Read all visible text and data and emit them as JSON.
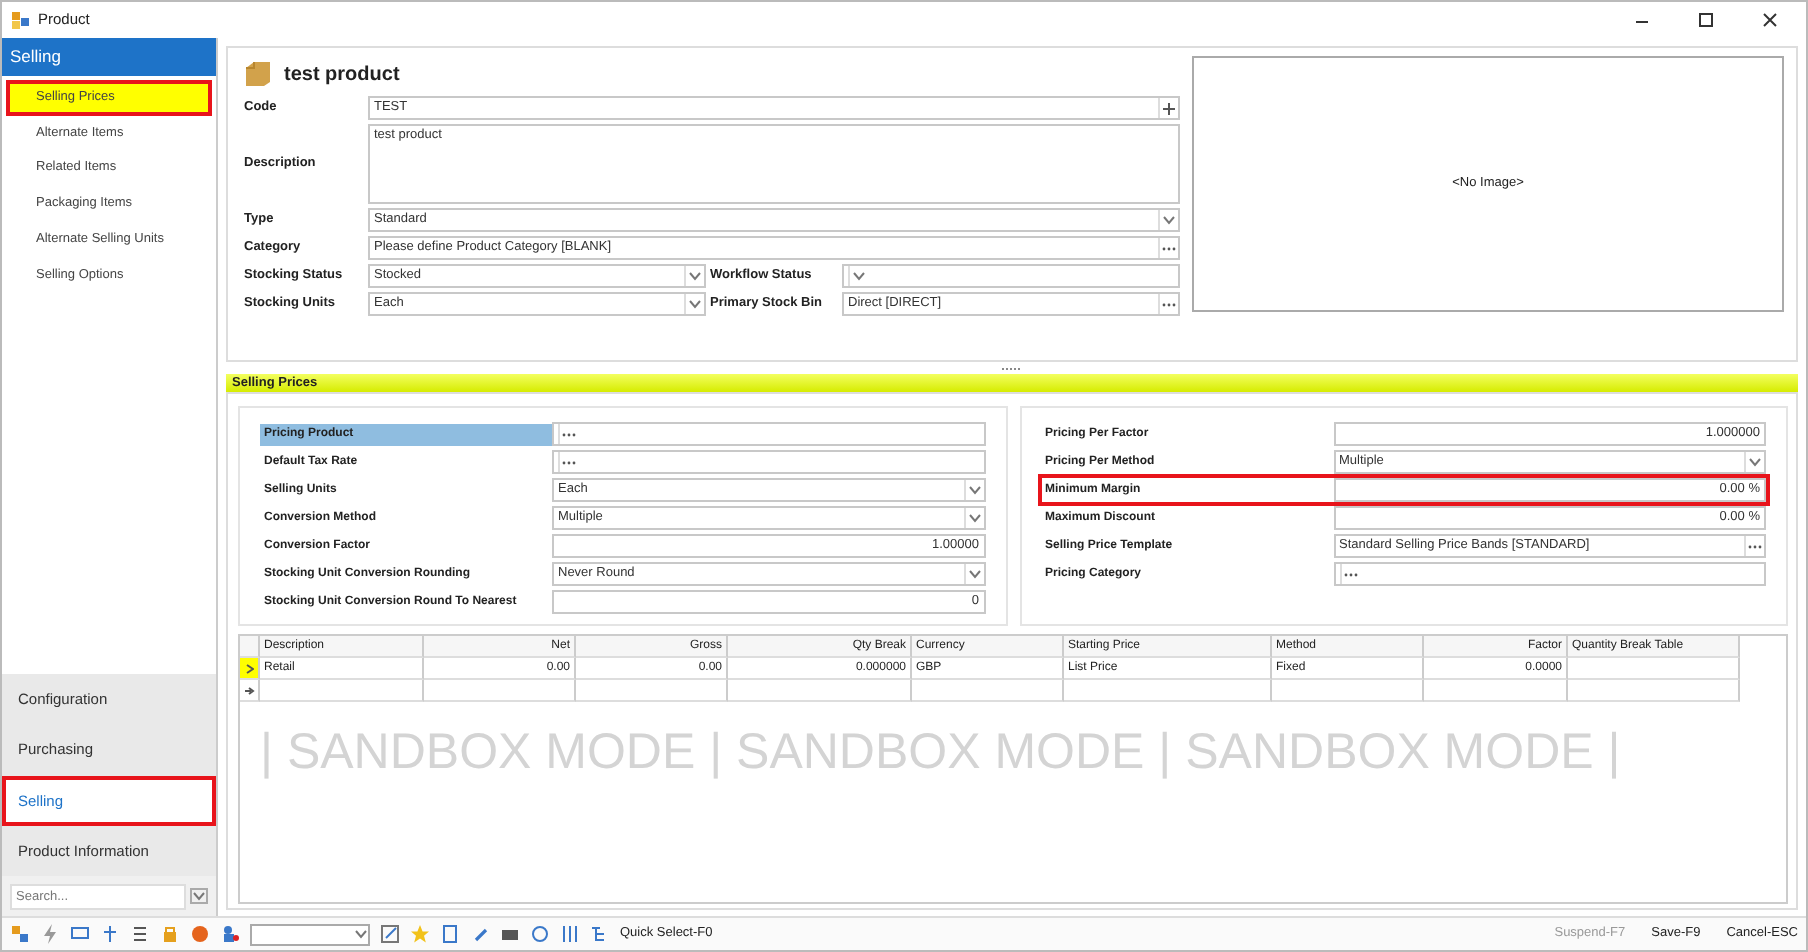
{
  "window": {
    "title": "Product"
  },
  "sidebar": {
    "header": "Selling",
    "items": [
      {
        "label": "Selling Prices",
        "selected": true,
        "highlighted": true
      },
      {
        "label": "Alternate Items",
        "selected": false,
        "highlighted": false
      },
      {
        "label": "Related Items",
        "selected": false,
        "highlighted": false
      },
      {
        "label": "Packaging Items",
        "selected": false,
        "highlighted": false
      },
      {
        "label": "Alternate Selling Units",
        "selected": false,
        "highlighted": false
      },
      {
        "label": "Selling Options",
        "selected": false,
        "highlighted": false
      }
    ],
    "nav": [
      {
        "label": "Configuration",
        "selected": false,
        "highlighted": false
      },
      {
        "label": "Purchasing",
        "selected": false,
        "highlighted": false
      },
      {
        "label": "Selling",
        "selected": true,
        "highlighted": true
      },
      {
        "label": "Product Information",
        "selected": false,
        "highlighted": false
      }
    ],
    "search": {
      "placeholder": "Search..."
    }
  },
  "product": {
    "name": "test product",
    "rows": [
      [
        {
          "label": "Code",
          "value": "TEST",
          "kind": "code"
        }
      ],
      [
        {
          "label": "Description",
          "value": "test product",
          "kind": "memo"
        }
      ],
      [
        {
          "label": "Type",
          "value": "Standard",
          "kind": "dropdown"
        }
      ],
      [
        {
          "label": "Category",
          "value": "Please define Product Category [BLANK]",
          "kind": "lookup"
        }
      ],
      [
        {
          "label": "Stocking Status",
          "value": "Stocked",
          "kind": "dropdown"
        },
        {
          "label": "Workflow Status",
          "kind": "dropdown"
        }
      ],
      [
        {
          "label": "Stocking Units",
          "value": "Each",
          "kind": "dropdown"
        },
        {
          "label": "Primary Stock Bin",
          "value": "Direct [DIRECT]",
          "kind": "lookup"
        }
      ]
    ],
    "image": {
      "text": "<No Image>"
    }
  },
  "section": {
    "title": "Selling Prices"
  },
  "pricing_left": [
    {
      "label": "Pricing Product",
      "kind": "lookup",
      "focused": true
    },
    {
      "label": "Default Tax Rate",
      "kind": "lookup",
      "focused": false
    },
    {
      "label": "Selling Units",
      "value": "Each",
      "kind": "dropdown",
      "focused": false
    },
    {
      "label": "Conversion Method",
      "value": "Multiple",
      "kind": "dropdown",
      "focused": false
    },
    {
      "label": "Conversion Factor",
      "value": "1.00000",
      "kind": "number",
      "focused": false
    },
    {
      "label": "Stocking Unit Conversion Rounding",
      "value": "Never Round",
      "kind": "dropdown",
      "focused": false
    },
    {
      "label": "Stocking Unit Conversion Round To Nearest",
      "value": "0",
      "kind": "number",
      "focused": false
    }
  ],
  "pricing_right": [
    {
      "label": "Pricing Per Factor",
      "value": "1.000000",
      "kind": "number",
      "focused": false
    },
    {
      "label": "Pricing Per Method",
      "value": "Multiple",
      "kind": "dropdown",
      "focused": false
    },
    {
      "label": "Minimum Margin",
      "value": "0.00 %",
      "kind": "number",
      "focused": false,
      "highlighted": true
    },
    {
      "label": "Maximum Discount",
      "value": "0.00 %",
      "kind": "number",
      "focused": false
    },
    {
      "label": "Selling Price Template",
      "value": "Standard Selling Price Bands [STANDARD]",
      "kind": "lookup",
      "focused": false
    },
    {
      "label": "Pricing Category",
      "kind": "lookup",
      "focused": false
    }
  ],
  "grid": {
    "columns": [
      {
        "label": "Description",
        "kind": "text"
      },
      {
        "label": "Net",
        "kind": "number"
      },
      {
        "label": "Gross",
        "kind": "number"
      },
      {
        "label": "Qty Break",
        "kind": "number"
      },
      {
        "label": "Currency",
        "kind": "text"
      },
      {
        "label": "Starting Price",
        "kind": "text"
      },
      {
        "label": "Method",
        "kind": "text"
      },
      {
        "label": "Factor",
        "kind": "number"
      },
      {
        "label": "Quantity Break Table",
        "kind": "text"
      }
    ],
    "rows": [
      {
        "current": true,
        "cells": [
          "Retail",
          "0.00",
          "0.00",
          "0.000000",
          "GBP",
          "List Price",
          "Fixed",
          "0.0000",
          null
        ]
      }
    ],
    "watermark": "| SANDBOX MODE | SANDBOX MODE | SANDBOX MODE |"
  },
  "toolbar": {
    "quick_select": "Quick Select-F0",
    "actions": [
      {
        "label": "Suspend-F7",
        "disabled": true
      },
      {
        "label": "Save-F9",
        "disabled": false
      },
      {
        "label": "Cancel-ESC",
        "disabled": false
      }
    ]
  }
}
